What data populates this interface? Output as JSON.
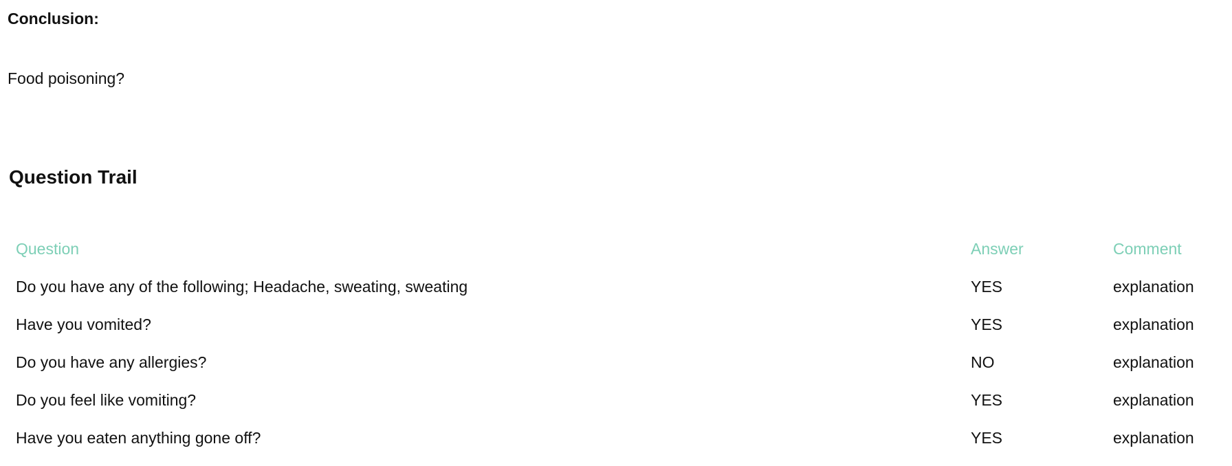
{
  "conclusion": {
    "label": "Conclusion:",
    "text": "Food poisoning?"
  },
  "trail": {
    "heading": "Question Trail",
    "columns": {
      "question": "Question",
      "answer": "Answer",
      "comment": "Comment"
    },
    "rows": [
      {
        "question": "Do you have any of the following; Headache, sweating, sweating",
        "answer": "YES",
        "comment": "explanation"
      },
      {
        "question": "Have you vomited?",
        "answer": "YES",
        "comment": "explanation"
      },
      {
        "question": "Do you have any allergies?",
        "answer": "NO",
        "comment": "explanation"
      },
      {
        "question": "Do you feel like vomiting?",
        "answer": "YES",
        "comment": "explanation"
      },
      {
        "question": "Have you eaten anything gone off?",
        "answer": "YES",
        "comment": "explanation"
      }
    ]
  },
  "colors": {
    "header_accent": "#7dcfb6"
  }
}
